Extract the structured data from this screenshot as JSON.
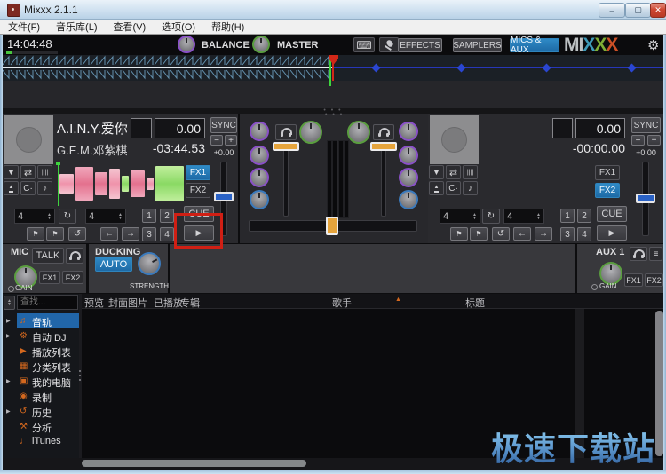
{
  "window": {
    "title": "Mixxx 2.1.1",
    "controls": {
      "minimize": "–",
      "maximize": "▢",
      "close": "✕"
    }
  },
  "menu": {
    "items": [
      {
        "label": "文件(F)"
      },
      {
        "label": "音乐库(L)"
      },
      {
        "label": "查看(V)"
      },
      {
        "label": "选项(O)"
      },
      {
        "label": "帮助(H)"
      }
    ]
  },
  "toolbar": {
    "clock": "14:04:48",
    "balance_label": "BALANCE",
    "master_label": "MASTER",
    "effects": "EFFECTS",
    "samplers": "SAMPLERS",
    "mics_aux": "MICS & AUX",
    "logo": {
      "mi": "MI",
      "x1": "X",
      "x2": "X",
      "x3": "X"
    }
  },
  "deck1": {
    "title": "A.I.N.Y.爱你",
    "artist": "G.E.M.邓紫棋",
    "key": "",
    "bpm": "0.00",
    "time": "-03:44.53",
    "sync": "SYNC",
    "pitch_minus": "−",
    "pitch_plus": "+",
    "pitch_value": "+0.00",
    "fx1": "FX1",
    "fx2": "FX2",
    "beatloop_size": "4",
    "beatjump_size": "4",
    "hotcues": [
      "1",
      "2",
      "3",
      "4"
    ],
    "cue": "CUE"
  },
  "deck2": {
    "title": "",
    "artist": "",
    "key": "",
    "bpm": "0.00",
    "time": "-00:00.00",
    "sync": "SYNC",
    "pitch_minus": "−",
    "pitch_plus": "+",
    "pitch_value": "+0.00",
    "fx1": "FX1",
    "fx2": "FX2",
    "beatloop_size": "4",
    "beatjump_size": "4",
    "hotcues": [
      "1",
      "2",
      "3",
      "4"
    ],
    "cue": "CUE"
  },
  "mic": {
    "label": "MIC",
    "talk": "TALK",
    "gain_label": "GAIN",
    "fx1": "FX1",
    "fx2": "FX2"
  },
  "ducking": {
    "label": "DUCKING",
    "auto": "AUTO",
    "strength_label": "STRENGTH"
  },
  "aux": {
    "label": "AUX 1",
    "gain_label": "GAIN",
    "fx1": "FX1",
    "fx2": "FX2"
  },
  "library": {
    "search_placeholder": "查找...",
    "sidebar": [
      {
        "label": "音轨",
        "icon": "♫",
        "expandable": true,
        "selected": true
      },
      {
        "label": "自动 DJ",
        "icon": "⚙",
        "expandable": true,
        "selected": false
      },
      {
        "label": "播放列表",
        "icon": "▶",
        "expandable": false,
        "selected": false
      },
      {
        "label": "分类列表",
        "icon": "▦",
        "expandable": false,
        "selected": false
      },
      {
        "label": "我的电脑",
        "icon": "▣",
        "expandable": true,
        "selected": false
      },
      {
        "label": "录制",
        "icon": "◉",
        "expandable": false,
        "selected": false
      },
      {
        "label": "历史",
        "icon": "↺",
        "expandable": true,
        "selected": false
      },
      {
        "label": "分析",
        "icon": "⚒",
        "expandable": false,
        "selected": false
      },
      {
        "label": "iTunes",
        "icon": "♩",
        "expandable": false,
        "selected": false
      }
    ],
    "columns": [
      "预览",
      "封面图片",
      "已播放",
      "专辑",
      "歌手",
      "标题"
    ],
    "sort_column": "歌手"
  },
  "icons": {
    "keyboard": "⌨",
    "gear": "⚙",
    "passthrough": "▼",
    "repeat": "⇄",
    "slip": "||||",
    "eject": "▲",
    "quantize": "C·",
    "keylock": "♪",
    "loop_toggle": "↻",
    "hotcue_flag": "⚑",
    "reloop": "↺",
    "arrow_left": "←",
    "arrow_right": "→",
    "play": "▶",
    "sort_asc": "▲",
    "eq": "≡",
    "spin_up": "▲",
    "spin_down": "▼",
    "dots": "• • •"
  },
  "watermark": "极速下载站",
  "colors": {
    "accent_blue": "#2471a8",
    "accent_orange": "#d4681e",
    "selection_blue": "#2166a9",
    "playhead_red": "#d22818",
    "cue_green": "#3ed43e",
    "fader_handle_orange": "#e5a43c",
    "pitch_handle_blue": "#2a62c6",
    "knob_purple": "#8a50c8",
    "knob_green": "#5a9e3f",
    "knob_blue": "#3a7abd"
  }
}
